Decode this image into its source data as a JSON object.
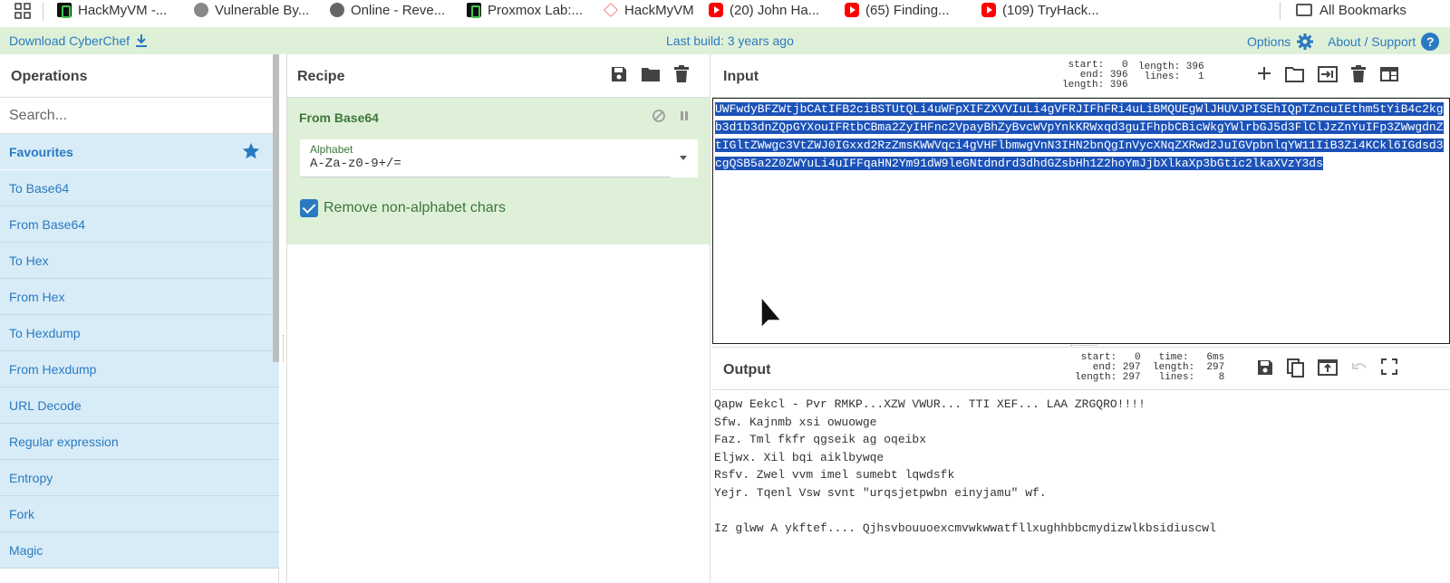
{
  "bookmarks": {
    "items": [
      {
        "label": "HackMyVM -...",
        "icon": "hackmyvm-icon"
      },
      {
        "label": "Vulnerable By...",
        "icon": "vulnhub-icon"
      },
      {
        "label": "Online - Reve...",
        "icon": "skull-icon"
      },
      {
        "label": "Proxmox Lab:...",
        "icon": "hackmyvm-icon"
      },
      {
        "label": "HackMyVM",
        "icon": "hackmyvm-diamond-icon"
      },
      {
        "label": "(20) John Ha...",
        "icon": "youtube-icon"
      },
      {
        "label": "(65) Finding...",
        "icon": "youtube-icon"
      },
      {
        "label": "(109) TryHack...",
        "icon": "youtube-icon"
      }
    ],
    "all_bookmarks": "All Bookmarks"
  },
  "banner": {
    "download": "Download CyberChef",
    "last_build": "Last build: 3 years ago",
    "options": "Options",
    "about": "About / Support"
  },
  "operations": {
    "title": "Operations",
    "search_placeholder": "Search...",
    "favourites": "Favourites",
    "items": [
      "To Base64",
      "From Base64",
      "To Hex",
      "From Hex",
      "To Hexdump",
      "From Hexdump",
      "URL Decode",
      "Regular expression",
      "Entropy",
      "Fork",
      "Magic"
    ]
  },
  "recipe": {
    "title": "Recipe",
    "operation": {
      "name": "From Base64",
      "alphabet_label": "Alphabet",
      "alphabet_value": "A-Za-z0-9+/=",
      "remove_label": "Remove non-alphabet chars",
      "remove_checked": true
    }
  },
  "input": {
    "title": "Input",
    "stats_left": "start:   0\n  end: 396\nlength: 396",
    "stats_right": "length: 396\n lines:   1",
    "text": "UWFwdyBFZWtjbCAtIFB2ciBSTUtQLi4uWFpXIFZXVVIuLi4gVFRJIFhFRi4uLiBMQUEgWlJHUVJPISEhIQpTZncuIEthm5tYiB4c2kgb3d1b3dnZQpGYXouIFRtbCBma2ZyIHFnc2VpayBhZyBvcWVpYnkKRWxqd3guIFhpbCBicWkgYWlrbGJ5d3FlClJzZnYuIFp3ZWwgdnZtIGltZWwgc3VtZWJ0IGxxd2RzZmsKWWVqci4gVHFlbmwgVnN3IHN2bnQgInVycXNqZXRwd2JuIGVpbnlqYW11IiB3Zi4KCkl6IGdsd3cgQSB5a2Z0ZWYuLi4uIFFqaHN2Ym91dW9leGNtdndrd3dhdGZsbHh1Z2hoYmJjbXlkaXp3bGtic2lkaXVzY3ds"
  },
  "output": {
    "title": "Output",
    "stats_left": "start:   0\n  end: 297\nlength: 297",
    "stats_right": "time:   6ms\nlength:  297\n lines:    8",
    "lines": [
      "Qapw Eekcl - Pvr RMKP...XZW VWUR... TTI XEF... LAA ZRGQRO!!!!",
      "Sfw. Kajnmb xsi owuowge",
      "Faz. Tml fkfr qgseik ag oqeibx",
      "Eljwx. Xil bqi aiklbywqe",
      "Rsfv. Zwel vvm imel sumebt lqwdsfk",
      "Yejr. Tqenl Vsw svnt \"urqsjetpwbn einyjamu\" wf.",
      "",
      "Iz glww A ykftef.... Qjhsvbouuoexcmvwkwwatfllxughhbbcmydizwlkbsidiuscwl"
    ]
  },
  "colors": {
    "accent": "#2a7ac0",
    "banner_bg": "#dff0d8",
    "op_bg": "#d8ecf8",
    "selection": "#1c52b8",
    "recipe_text": "#3c763d"
  }
}
